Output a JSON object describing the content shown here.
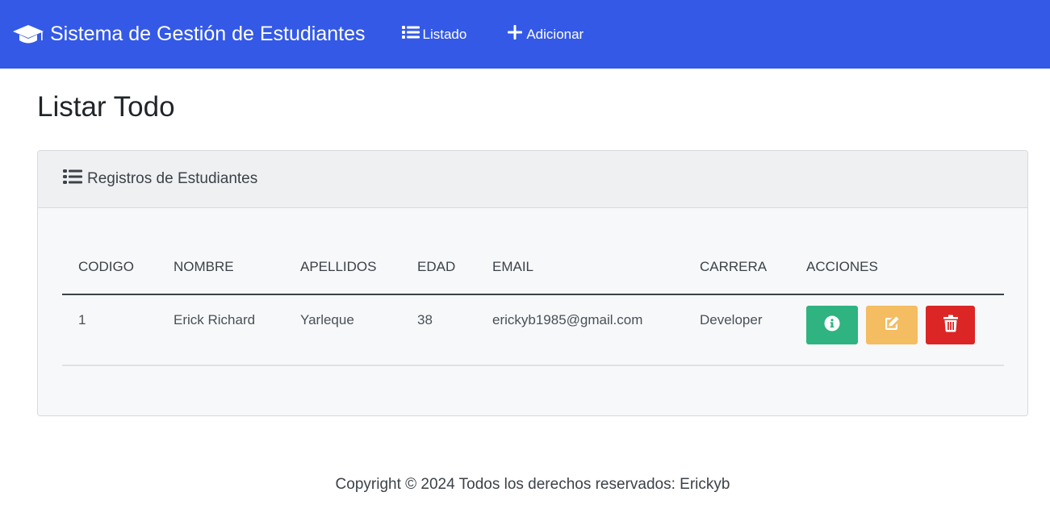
{
  "navbar": {
    "brand": "Sistema de Gestión de Estudiantes",
    "brand_icon": "graduation-cap-icon",
    "links": [
      {
        "label": "Listado",
        "icon": "list-icon"
      },
      {
        "label": "Adicionar",
        "icon": "plus-icon"
      }
    ],
    "background": "#3459e6"
  },
  "page": {
    "title": "Listar Todo"
  },
  "card": {
    "header": "Registros de Estudiantes",
    "header_icon": "list-icon"
  },
  "table": {
    "columns": [
      "CODIGO",
      "NOMBRE",
      "APELLIDOS",
      "EDAD",
      "EMAIL",
      "CARRERA",
      "ACCIONES"
    ],
    "rows": [
      {
        "codigo": "1",
        "nombre": "Erick Richard",
        "apellidos": "Yarleque",
        "edad": "38",
        "email": "erickyb1985@gmail.com",
        "carrera": "Developer",
        "actions": [
          {
            "name": "info",
            "icon": "info-circle-icon",
            "color": "#2fb380"
          },
          {
            "name": "edit",
            "icon": "edit-icon",
            "color": "#f4bd61"
          },
          {
            "name": "delete",
            "icon": "trash-icon",
            "color": "#dc2626"
          }
        ]
      }
    ]
  },
  "footer": {
    "text": "Copyright © 2024 Todos los derechos reservados: Erickyb"
  }
}
